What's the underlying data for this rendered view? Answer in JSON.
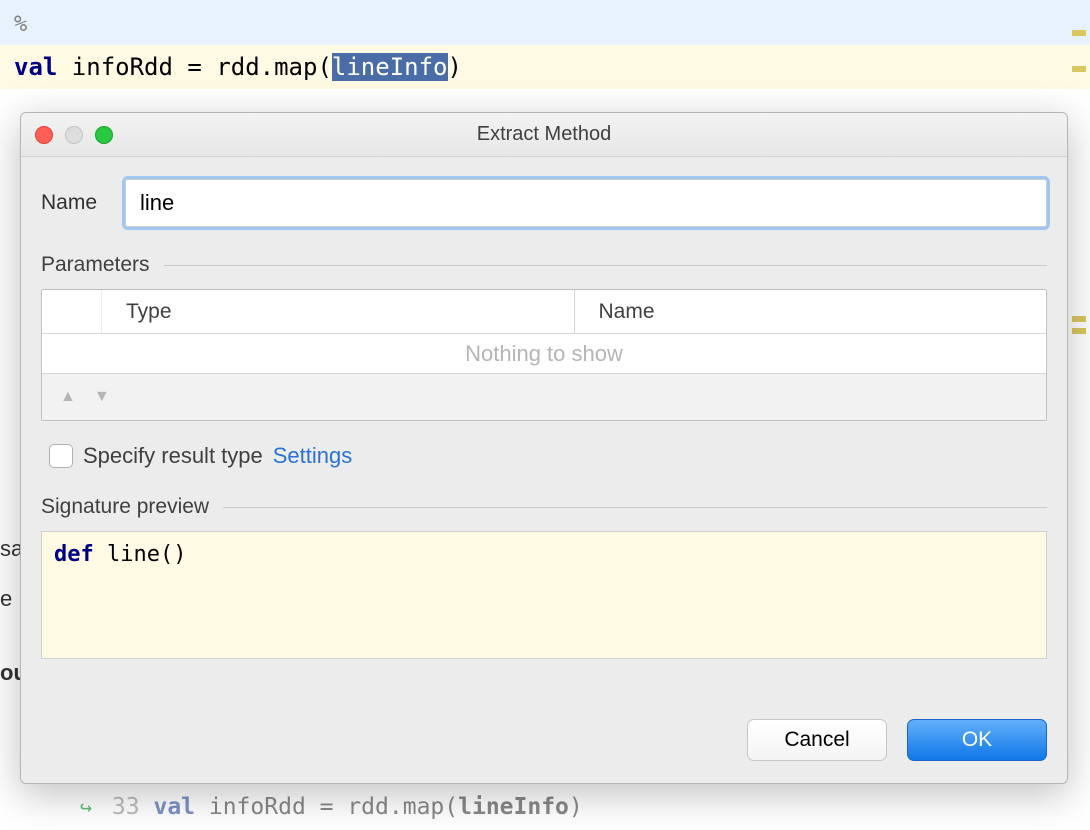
{
  "editor": {
    "top_marker": "%",
    "code_line": {
      "keyword": "val",
      "var_name": " infoRdd ",
      "equals": "= ",
      "expr_pre": "rdd.map(",
      "selected": "lineInfo",
      "expr_post": ")"
    },
    "bottom_line": {
      "line_num": "33",
      "keyword": "val",
      "text1": " infoRdd = rdd.map(",
      "bold": "lineInfo",
      "text2": ")"
    },
    "side_fragments": {
      "sa": "sa",
      "e": "e",
      "ou": "ou"
    }
  },
  "dialog": {
    "title": "Extract Method",
    "name_label": "Name",
    "name_value": "line",
    "parameters_label": "Parameters",
    "columns": {
      "type": "Type",
      "name": "Name"
    },
    "empty_text": "Nothing to show",
    "specify_result_label": "Specify result type",
    "settings_link": "Settings",
    "signature_label": "Signature preview",
    "signature": {
      "keyword": "def",
      "rest": " line()"
    },
    "buttons": {
      "cancel": "Cancel",
      "ok": "OK"
    }
  }
}
